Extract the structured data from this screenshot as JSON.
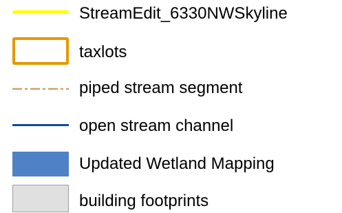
{
  "legend": {
    "items": [
      {
        "label": "StreamEdit_6330NWSkyline",
        "symbol": "line",
        "color": "#ffff00",
        "icon": "solid-line-symbol"
      },
      {
        "label": "taxlots",
        "symbol": "outline-box",
        "color": "#e69800",
        "fill": "#ffffff",
        "icon": "outline-polygon-symbol"
      },
      {
        "label": "piped stream segment",
        "symbol": "dash-dot-line",
        "color": "#c8a46c",
        "icon": "dash-dot-line-symbol"
      },
      {
        "label": "open stream channel",
        "symbol": "line",
        "color": "#0c4aa6",
        "icon": "solid-line-symbol"
      },
      {
        "label": "Updated Wetland Mapping",
        "symbol": "filled-box",
        "color": "#4f81c6",
        "icon": "filled-polygon-symbol"
      },
      {
        "label": "building footprints",
        "symbol": "filled-box",
        "color": "#e0e0e0",
        "outline": "#9e9e9e",
        "icon": "filled-polygon-symbol"
      }
    ]
  }
}
